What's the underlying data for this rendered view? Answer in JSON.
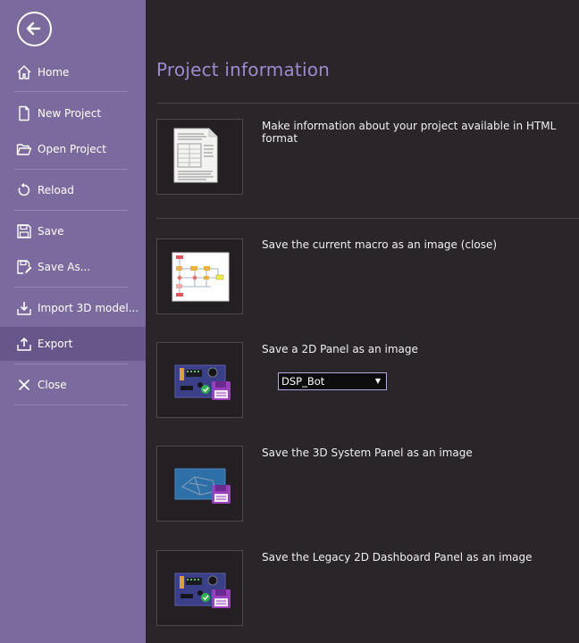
{
  "sidebar": {
    "back_icon": "back-arrow-circle-icon",
    "items": [
      {
        "label": "Home",
        "icon": "home-icon"
      },
      {
        "label": "New Project",
        "icon": "new-document-icon"
      },
      {
        "label": "Open Project",
        "icon": "open-folder-icon"
      },
      {
        "label": "Reload",
        "icon": "reload-icon"
      },
      {
        "label": "Save",
        "icon": "floppy-save-icon"
      },
      {
        "label": "Save As...",
        "icon": "save-as-icon"
      },
      {
        "label": "Import 3D model...",
        "icon": "import-icon"
      },
      {
        "label": "Export",
        "icon": "export-icon",
        "active": true
      },
      {
        "label": "Close",
        "icon": "close-x-icon"
      }
    ]
  },
  "main": {
    "title": "Project information",
    "options": [
      {
        "description": "Make information about your project available in HTML format",
        "icon": "html-document-icon"
      },
      {
        "description": "Save the current macro as an image (close)",
        "icon": "flowchart-macro-icon"
      },
      {
        "description": "Save a 2D Panel as an image",
        "icon": "panel-2d-save-icon"
      },
      {
        "description": "Save the 3D System Panel as an image",
        "icon": "panel-3d-save-icon"
      },
      {
        "description": "Save the Legacy 2D Dashboard Panel as an image",
        "icon": "dashboard-2d-save-icon"
      }
    ],
    "panel_select": {
      "value": "DSP_Bot"
    }
  },
  "colors": {
    "sidebar_bg": "#7b6a9d",
    "sidebar_active": "#66568a",
    "main_bg": "#2a2529",
    "title": "#9c8bd0",
    "accent_purple": "#9c3fbf"
  }
}
